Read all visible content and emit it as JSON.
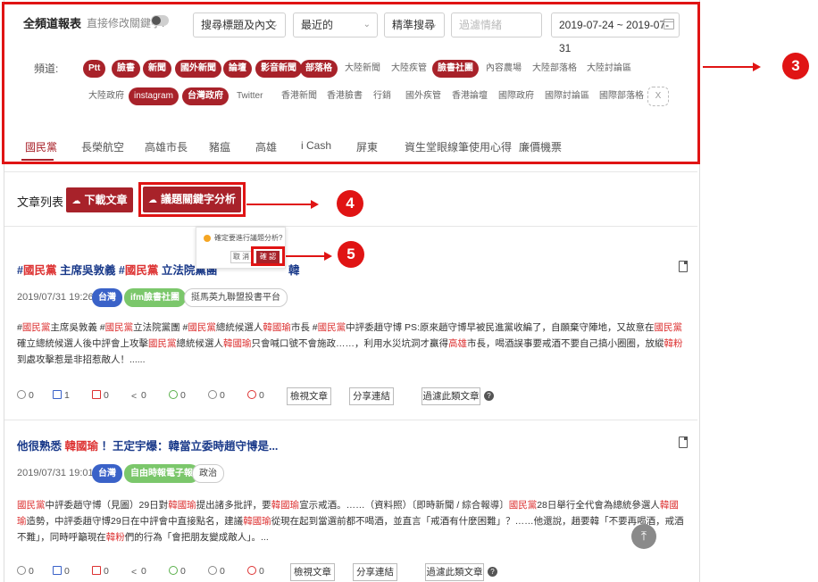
{
  "header": {
    "title": "全頻道報表",
    "edit_keyword_label": "直接修改關鍵字:",
    "search_scope": "搜尋標題及內文",
    "sort": "最近的",
    "search_mode": "精準搜尋",
    "filter_placeholder": "過濾情緒",
    "date_range": "2019-07-24 ~ 2019-07-31"
  },
  "channels": {
    "label": "頻道:",
    "row1": [
      {
        "label": "Ptt",
        "active": true
      },
      {
        "label": "臉書",
        "active": true
      },
      {
        "label": "新聞",
        "active": true
      },
      {
        "label": "國外新聞",
        "active": true
      },
      {
        "label": "論壇",
        "active": true
      },
      {
        "label": "影音新聞",
        "active": true
      },
      {
        "label": "部落格",
        "active": true
      },
      {
        "label": "大陸新聞",
        "active": false
      },
      {
        "label": "大陸疾管",
        "active": false
      },
      {
        "label": "臉書社團",
        "active": true
      },
      {
        "label": "內容農場",
        "active": false
      },
      {
        "label": "大陸部落格",
        "active": false
      },
      {
        "label": "大陸討論區",
        "active": false
      }
    ],
    "row2": [
      {
        "label": "大陸政府",
        "active": false
      },
      {
        "label": "instagram",
        "active": true
      },
      {
        "label": "台灣政府",
        "active": true
      },
      {
        "label": "Twitter",
        "active": false
      },
      {
        "label": "香港新聞",
        "active": false
      },
      {
        "label": "香港臉書",
        "active": false
      },
      {
        "label": "行銷",
        "active": false
      },
      {
        "label": "國外疾管",
        "active": false
      },
      {
        "label": "香港論壇",
        "active": false
      },
      {
        "label": "國際政府",
        "active": false
      },
      {
        "label": "國際討論區",
        "active": false
      },
      {
        "label": "國際部落格",
        "active": false
      }
    ],
    "close": "X"
  },
  "topics": [
    "國民黨",
    "長榮航空",
    "高雄市長",
    "豬瘟",
    "高雄",
    "i Cash",
    "屏東",
    "資生堂眼線筆使用心得",
    "廉價機票"
  ],
  "list": {
    "title": "文章列表",
    "download": "下載文章",
    "keyword_analysis": "議題關鍵字分析"
  },
  "popover": {
    "text": "確定要進行議題分析?",
    "cancel": "取 消",
    "confirm": "確 認"
  },
  "callouts": [
    "3",
    "4",
    "5"
  ],
  "articles": [
    {
      "title_parts": [
        {
          "t": "#",
          "hl": false
        },
        {
          "t": "國民黨",
          "hl": true
        },
        {
          "t": " 主席吳敦義 #",
          "hl": false
        },
        {
          "t": "國民黨",
          "hl": true
        },
        {
          "t": " 立法院黨團",
          "hl": false
        }
      ],
      "title_tail": "韓",
      "date": "2019/07/31 19:26",
      "tags": [
        "台灣",
        "ifm臉書社團",
        "挺馬英九聯盟投書平台"
      ],
      "body": [
        {
          "t": "#",
          "hl": false
        },
        {
          "t": "國民黨",
          "hl": true
        },
        {
          "t": "主席吳敦義 #",
          "hl": false
        },
        {
          "t": "國民黨",
          "hl": true
        },
        {
          "t": "立法院黨團 #",
          "hl": false
        },
        {
          "t": "國民黨",
          "hl": true
        },
        {
          "t": "總統候選人",
          "hl": false
        },
        {
          "t": "韓國瑜",
          "hl": true
        },
        {
          "t": "市長 #",
          "hl": false
        },
        {
          "t": "國民黨",
          "hl": true
        },
        {
          "t": "中評委趙守博 PS:原來趙守博早被民進黨收編了，自願棄守陣地，又故意在",
          "hl": false
        },
        {
          "t": "國民黨",
          "hl": true
        },
        {
          "t": "確立總統候選人後中評會上攻擊",
          "hl": false
        },
        {
          "t": "國民黨",
          "hl": true
        },
        {
          "t": "總統候選人",
          "hl": false
        },
        {
          "t": "韓國瑜",
          "hl": true
        },
        {
          "t": "只會喊口號不會施政……，利用水災坑洞才贏得",
          "hl": false
        },
        {
          "t": "高雄",
          "hl": true
        },
        {
          "t": "市長，喝酒誤事要戒酒不要自己搞小圈圈，放縱",
          "hl": false
        },
        {
          "t": "韓粉",
          "hl": true
        },
        {
          "t": "到處攻擊惹是非招惹敵人！......",
          "hl": false
        }
      ],
      "stats": {
        "comments": "0",
        "likes": "1",
        "dislikes": "0",
        "shares": "0",
        "happy": "0",
        "neutral": "0",
        "angry": "0"
      }
    },
    {
      "title_parts": [
        {
          "t": "他很熟悉 ",
          "hl": false
        },
        {
          "t": "韓國瑜",
          "hl": true
        },
        {
          "t": " ！王定宇爆：韓當立委時趙守博是...",
          "hl": false
        }
      ],
      "title_tail": "",
      "date": "2019/07/31 19:01",
      "tags": [
        "台灣",
        "自由時報電子報",
        "政治"
      ],
      "body": [
        {
          "t": "國民黨",
          "hl": true
        },
        {
          "t": "中評委趙守博（見圖）29日對",
          "hl": false
        },
        {
          "t": "韓國瑜",
          "hl": true
        },
        {
          "t": "提出諸多批評，要",
          "hl": false
        },
        {
          "t": "韓國瑜",
          "hl": true
        },
        {
          "t": "宣示戒酒。……（資料照）〔即時新聞 / 綜合報導〕",
          "hl": false
        },
        {
          "t": "國民黨",
          "hl": true
        },
        {
          "t": "28日舉行全代會為總統參選人",
          "hl": false
        },
        {
          "t": "韓國瑜",
          "hl": true
        },
        {
          "t": "造勢，中評委趙守博29日在中評會中直接點名，建議",
          "hl": false
        },
        {
          "t": "韓國瑜",
          "hl": true
        },
        {
          "t": "從現在起到當選前都不喝酒，並直言「戒酒有什麼困難」？……他還說，趙要韓「不要再喝酒，戒酒不難」，同時呼籲現在",
          "hl": false
        },
        {
          "t": "韓粉",
          "hl": true
        },
        {
          "t": "們的行為「會把朋友變成敵人」。...",
          "hl": false
        }
      ],
      "stats": {
        "comments": "0",
        "likes": "0",
        "dislikes": "0",
        "shares": "0",
        "happy": "0",
        "neutral": "0",
        "angry": "0"
      }
    }
  ],
  "article_actions": {
    "view": "檢視文章",
    "share": "分享連結",
    "filter": "過濾此類文章",
    "help": "?"
  },
  "scroll_top_icon": "arrow-up-icon",
  "colors": {
    "brand": "#a8222a",
    "annotation": "#e01414",
    "link": "#1a3a8a",
    "highlight": "#d33333"
  }
}
